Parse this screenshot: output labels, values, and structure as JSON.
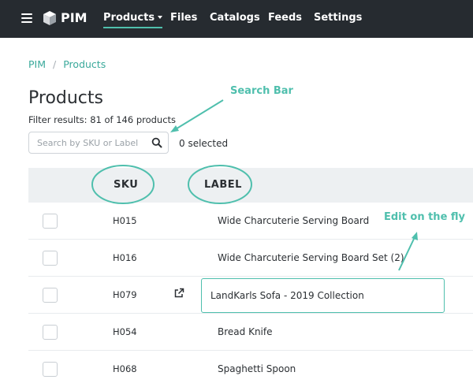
{
  "app": {
    "name": "PIM"
  },
  "nav": {
    "items": [
      {
        "label": "Products",
        "active": true,
        "dropdown": true
      },
      {
        "label": "Files"
      },
      {
        "label": "Catalogs"
      },
      {
        "label": "Feeds"
      },
      {
        "label": "Settings"
      }
    ]
  },
  "breadcrumb": {
    "items": [
      "PIM",
      "Products"
    ],
    "separator": "/"
  },
  "page": {
    "title": "Products",
    "filter_results": "Filter results: 81 of 146 products"
  },
  "search": {
    "placeholder": "Search by SKU or Label",
    "value": ""
  },
  "selection": {
    "count_text": "0 selected"
  },
  "table": {
    "columns": [
      "SKU",
      "LABEL"
    ],
    "rows": [
      {
        "sku": "H015",
        "label": "Wide Charcuterie Serving Board"
      },
      {
        "sku": "H016",
        "label": "Wide Charcuterie Serving Board Set (2)"
      },
      {
        "sku": "H079",
        "label": "LandKarls Sofa - 2019 Collection",
        "editing": true
      },
      {
        "sku": "H054",
        "label": "Bread Knife"
      },
      {
        "sku": "H068",
        "label": "Spaghetti Spoon"
      }
    ]
  },
  "annotations": {
    "search_bar": "Search Bar",
    "edit_on_the_fly": "Edit on the fly"
  },
  "colors": {
    "nav_bg": "#262b30",
    "accent": "#4fbfad",
    "link": "#3aa99b",
    "header_bg": "#edf0f2"
  },
  "icons": [
    "menu-icon",
    "cube-logo-icon",
    "chevron-down-icon",
    "search-icon",
    "external-link-icon"
  ]
}
